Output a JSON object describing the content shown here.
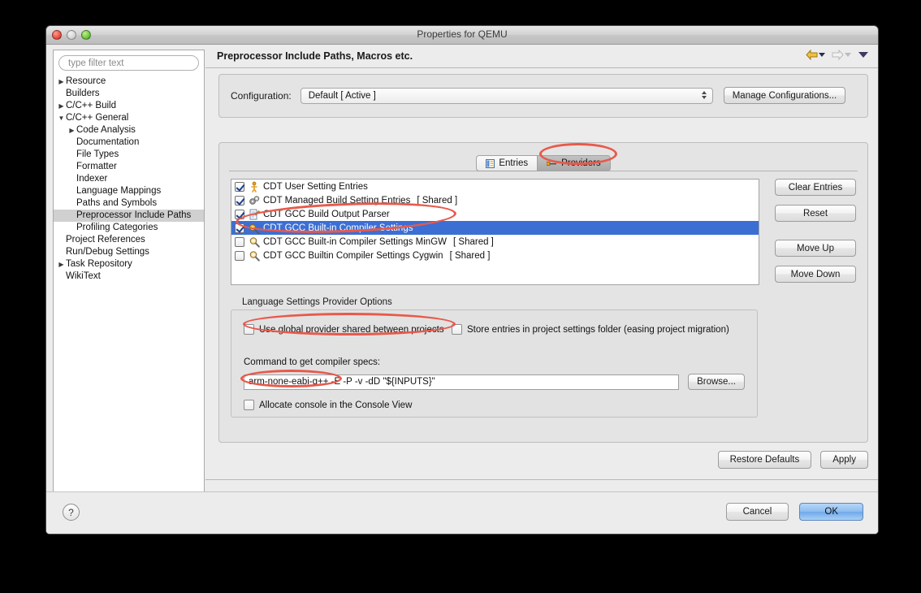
{
  "window": {
    "title": "Properties for QEMU",
    "traffic_lights": [
      "close-red",
      "minimize-inactive",
      "zoom-green"
    ]
  },
  "sidebar": {
    "filter": {
      "placeholder": "type filter text",
      "value": ""
    },
    "items": [
      {
        "label": "Resource",
        "indent": 0,
        "twisty": "collapsed",
        "selected": false
      },
      {
        "label": "Builders",
        "indent": 0,
        "twisty": "none",
        "selected": false
      },
      {
        "label": "C/C++ Build",
        "indent": 0,
        "twisty": "collapsed",
        "selected": false
      },
      {
        "label": "C/C++ General",
        "indent": 0,
        "twisty": "expanded",
        "selected": false
      },
      {
        "label": "Code Analysis",
        "indent": 1,
        "twisty": "collapsed",
        "selected": false
      },
      {
        "label": "Documentation",
        "indent": 1,
        "twisty": "none",
        "selected": false
      },
      {
        "label": "File Types",
        "indent": 1,
        "twisty": "none",
        "selected": false
      },
      {
        "label": "Formatter",
        "indent": 1,
        "twisty": "none",
        "selected": false
      },
      {
        "label": "Indexer",
        "indent": 1,
        "twisty": "none",
        "selected": false
      },
      {
        "label": "Language Mappings",
        "indent": 1,
        "twisty": "none",
        "selected": false
      },
      {
        "label": "Paths and Symbols",
        "indent": 1,
        "twisty": "none",
        "selected": false
      },
      {
        "label": "Preprocessor Include Paths",
        "indent": 1,
        "twisty": "none",
        "selected": true
      },
      {
        "label": "Profiling Categories",
        "indent": 1,
        "twisty": "none",
        "selected": false
      },
      {
        "label": "Project References",
        "indent": 0,
        "twisty": "none",
        "selected": false
      },
      {
        "label": "Run/Debug Settings",
        "indent": 0,
        "twisty": "none",
        "selected": false
      },
      {
        "label": "Task Repository",
        "indent": 0,
        "twisty": "collapsed",
        "selected": false
      },
      {
        "label": "WikiText",
        "indent": 0,
        "twisty": "none",
        "selected": false
      }
    ]
  },
  "panel": {
    "title": "Preprocessor Include Paths, Macros etc.",
    "nav": {
      "back_icon": "back-arrow-icon",
      "forward_icon": "forward-arrow-icon",
      "menu_icon": "chevron-down-icon"
    }
  },
  "configuration": {
    "label": "Configuration:",
    "value": "Default  [ Active ]",
    "manage_label": "Manage Configurations..."
  },
  "tabs": [
    {
      "label": "Entries",
      "icon": "entries-table-icon",
      "active": false
    },
    {
      "label": "Providers",
      "icon": "providers-plug-icon",
      "active": true
    }
  ],
  "providers": [
    {
      "label": "CDT User Setting Entries",
      "shared": "",
      "checked": true,
      "selected": false,
      "icon": "user-person-icon"
    },
    {
      "label": "CDT Managed Build Setting Entries",
      "shared": "[ Shared ]",
      "checked": true,
      "selected": false,
      "icon": "gears-icon"
    },
    {
      "label": "CDT GCC Build Output Parser",
      "shared": "",
      "checked": true,
      "selected": false,
      "icon": "document-pencil-icon"
    },
    {
      "label": "CDT GCC Built-in Compiler Settings",
      "shared": "",
      "checked": true,
      "selected": true,
      "icon": "gear-wrench-icon"
    },
    {
      "label": "CDT GCC Built-in Compiler Settings MinGW",
      "shared": "[ Shared ]",
      "checked": false,
      "selected": false,
      "icon": "magnifier-icon"
    },
    {
      "label": "CDT GCC Builtin Compiler Settings Cygwin",
      "shared": "[ Shared ]",
      "checked": false,
      "selected": false,
      "icon": "magnifier-icon"
    }
  ],
  "side_buttons": {
    "clear_entries": "Clear Entries",
    "reset": "Reset",
    "move_up": "Move Up",
    "move_down": "Move Down"
  },
  "options_group": {
    "legend": "Language Settings Provider Options",
    "use_global": {
      "label": "Use global provider shared between projects",
      "checked": false
    },
    "store_entries": {
      "label": "Store entries in project settings folder (easing project migration)",
      "checked": false
    },
    "command_label": "Command to get compiler specs:",
    "command_value": "arm-none-eabi-g++ -E -P -v -dD \"${INPUTS}\"",
    "browse_label": "Browse...",
    "allocate_console": {
      "label": "Allocate console in the Console View",
      "checked": false
    }
  },
  "panel_buttons": {
    "restore_defaults": "Restore Defaults",
    "apply": "Apply"
  },
  "footer": {
    "help": "?",
    "cancel": "Cancel",
    "ok": "OK"
  },
  "colors": {
    "selection_blue": "#3b6fd4",
    "annotation_red": "#e8594b",
    "ok_button_blue": "#8dbdf0",
    "window_bg": "#ececec"
  },
  "annotations": [
    {
      "name": "providers-tab-highlight"
    },
    {
      "name": "checked-providers-highlight"
    },
    {
      "name": "use-global-provider-highlight"
    },
    {
      "name": "compiler-command-highlight"
    }
  ]
}
